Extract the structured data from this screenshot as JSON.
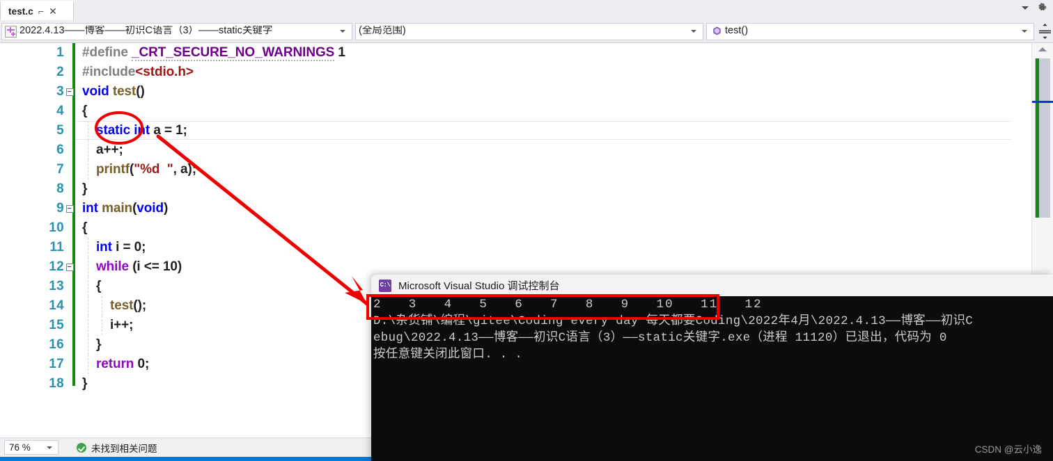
{
  "window": {
    "tab": {
      "label": "test.c",
      "pin_icon": "pin-icon",
      "close_icon": "close-icon"
    },
    "titlebar_right": {
      "chevron_icon": "chevron-down-icon",
      "gear_icon": "gear-icon"
    }
  },
  "navbar": {
    "file_combo": {
      "value": "2022.4.13——博客——初识C语言（3）——static关键字",
      "icon": "new-file-icon"
    },
    "scope_combo": {
      "value": "(全局范围)"
    },
    "member_combo": {
      "value": "test()",
      "icon": "method-icon"
    },
    "split_icon": "split-view-icon"
  },
  "editor": {
    "lines": [
      {
        "n": "1",
        "fold": false,
        "indent": 0,
        "tokens": [
          {
            "t": "#define ",
            "c": "pre"
          },
          {
            "t": "_CRT_SECURE_NO_WARNINGS",
            "c": "macro squiggle"
          },
          {
            "t": " 1",
            "c": "plain"
          }
        ]
      },
      {
        "n": "2",
        "fold": false,
        "indent": 0,
        "tokens": [
          {
            "t": "#include",
            "c": "pre"
          },
          {
            "t": "<stdio.h>",
            "c": "str"
          }
        ]
      },
      {
        "n": "3",
        "fold": true,
        "indent": 0,
        "tokens": [
          {
            "t": "void",
            "c": "kw"
          },
          {
            "t": " ",
            "c": "plain"
          },
          {
            "t": "test",
            "c": "fn"
          },
          {
            "t": "()",
            "c": "plain"
          }
        ]
      },
      {
        "n": "4",
        "fold": false,
        "indent": 0,
        "tokens": [
          {
            "t": "{",
            "c": "plain"
          }
        ]
      },
      {
        "n": "5",
        "fold": false,
        "indent": 1,
        "current": true,
        "tokens": [
          {
            "t": "static",
            "c": "kw"
          },
          {
            "t": " ",
            "c": "plain"
          },
          {
            "t": "int",
            "c": "kw"
          },
          {
            "t": " a = 1;",
            "c": "plain"
          }
        ]
      },
      {
        "n": "6",
        "fold": false,
        "indent": 1,
        "tokens": [
          {
            "t": "a++;",
            "c": "plain"
          }
        ]
      },
      {
        "n": "7",
        "fold": false,
        "indent": 1,
        "tokens": [
          {
            "t": "printf",
            "c": "fn"
          },
          {
            "t": "(",
            "c": "plain"
          },
          {
            "t": "\"%d  \"",
            "c": "str"
          },
          {
            "t": ", a);",
            "c": "plain"
          }
        ]
      },
      {
        "n": "8",
        "fold": false,
        "indent": 0,
        "tokens": [
          {
            "t": "}",
            "c": "plain"
          }
        ]
      },
      {
        "n": "9",
        "fold": true,
        "indent": 0,
        "tokens": [
          {
            "t": "int",
            "c": "kw"
          },
          {
            "t": " ",
            "c": "plain"
          },
          {
            "t": "main",
            "c": "fn"
          },
          {
            "t": "(",
            "c": "plain"
          },
          {
            "t": "void",
            "c": "kw"
          },
          {
            "t": ")",
            "c": "plain"
          }
        ]
      },
      {
        "n": "10",
        "fold": false,
        "indent": 0,
        "tokens": [
          {
            "t": "{",
            "c": "plain"
          }
        ]
      },
      {
        "n": "11",
        "fold": false,
        "indent": 1,
        "tokens": [
          {
            "t": "int",
            "c": "kw"
          },
          {
            "t": " i = 0;",
            "c": "plain"
          }
        ]
      },
      {
        "n": "12",
        "fold": true,
        "indent": 1,
        "tokens": [
          {
            "t": "while",
            "c": "ctl"
          },
          {
            "t": " (i <= 10)",
            "c": "plain"
          }
        ]
      },
      {
        "n": "13",
        "fold": false,
        "indent": 1,
        "tokens": [
          {
            "t": "{",
            "c": "plain"
          }
        ]
      },
      {
        "n": "14",
        "fold": false,
        "indent": 2,
        "tokens": [
          {
            "t": "test",
            "c": "fn"
          },
          {
            "t": "();",
            "c": "plain"
          }
        ]
      },
      {
        "n": "15",
        "fold": false,
        "indent": 2,
        "tokens": [
          {
            "t": "i++;",
            "c": "plain"
          }
        ]
      },
      {
        "n": "16",
        "fold": false,
        "indent": 1,
        "tokens": [
          {
            "t": "}",
            "c": "plain"
          }
        ]
      },
      {
        "n": "17",
        "fold": false,
        "indent": 1,
        "tokens": [
          {
            "t": "return",
            "c": "ctl"
          },
          {
            "t": " 0;",
            "c": "plain"
          }
        ]
      },
      {
        "n": "18",
        "fold": false,
        "indent": 0,
        "tokens": [
          {
            "t": "}",
            "c": "plain"
          }
        ]
      }
    ]
  },
  "scrollbar": {
    "up_arrow_icon": "scroll-up-arrow-icon"
  },
  "statusbar": {
    "zoom": "76 %",
    "problems_icon": "ok-check-icon",
    "problems_text": "未找到相关问题"
  },
  "console": {
    "title": "Microsoft Visual Studio 调试控制台",
    "icon": "console-icon",
    "output_numbers": "2   3   4   5   6   7   8   9   10   11   12",
    "line_path": "D:\\杂货铺\\编程\\gitee\\Coding every day 每天都要Coding\\2022年4月\\2022.4.13——博客——初识C",
    "line_exit": "ebug\\2022.4.13——博客——初识C语言（3）——static关键字.exe（进程 11120）已退出，代码为 0",
    "line_prompt": "按任意键关闭此窗口. . ."
  },
  "annotations": {
    "ellipse_target": "static",
    "arrow": "static-to-output-arrow",
    "highlight_box": "console-output-highlight"
  },
  "watermark": "CSDN @云小逸",
  "colors": {
    "keyword_blue": "#0000ff",
    "control_purple": "#8f08c4",
    "macro_purple": "#6f008a",
    "string_red": "#a31515",
    "function_gold": "#795e26",
    "linenum_teal": "#2b91af",
    "changebar_green": "#108a10",
    "ink_red": "#ee0000",
    "accent_blue": "#0078d4"
  }
}
